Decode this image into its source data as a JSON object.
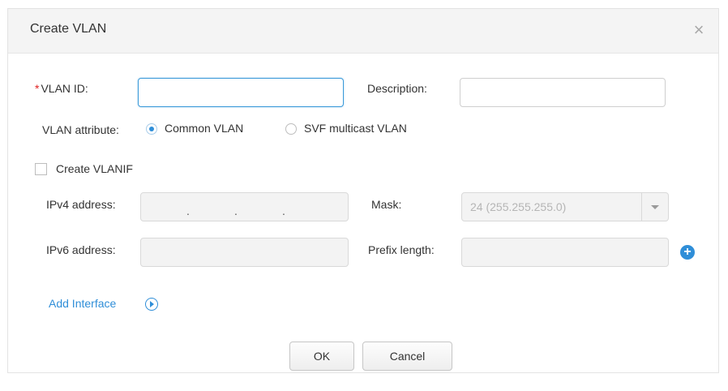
{
  "dialog": {
    "title": "Create VLAN",
    "close_glyph": "×"
  },
  "form": {
    "vlan_id": {
      "required_mark": "*",
      "label": "VLAN ID:",
      "value": ""
    },
    "description": {
      "label": "Description:",
      "value": ""
    },
    "vlan_attribute": {
      "label": "VLAN attribute:",
      "options": [
        "Common VLAN",
        "SVF multicast VLAN"
      ],
      "selected": "Common VLAN"
    },
    "create_vlanif": {
      "label": "Create VLANIF",
      "checked": false
    },
    "ipv4_address": {
      "label": "IPv4 address:",
      "separator": "."
    },
    "mask": {
      "label": "Mask:",
      "value": "24 (255.255.255.0)"
    },
    "ipv6_address": {
      "label": "IPv6 address:",
      "value": ""
    },
    "prefix_length": {
      "label": "Prefix length:",
      "value": ""
    },
    "add_interface": {
      "label": "Add Interface"
    }
  },
  "buttons": {
    "ok": "OK",
    "cancel": "Cancel"
  },
  "icons": {
    "close": "close-icon",
    "add": "plus-circle-icon",
    "expand": "circle-arrow-right-icon",
    "dropdown": "chevron-down-icon"
  },
  "colors": {
    "accent": "#2f8ed8",
    "required": "#e02020",
    "header_bg": "#f4f4f4",
    "focus_border": "#3b9ad9"
  }
}
